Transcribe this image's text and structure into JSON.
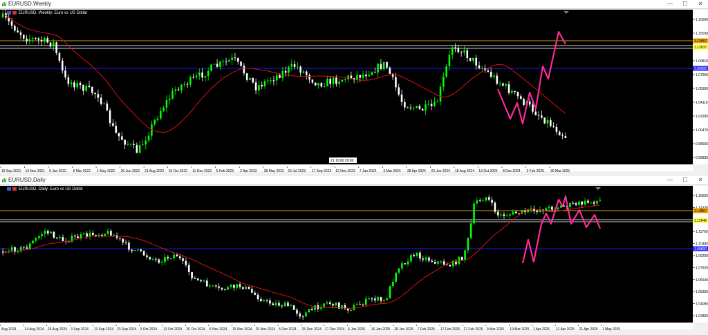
{
  "weekly": {
    "window_title": "EURUSD,Weekly",
    "chart_label": "EURUSD, Weekly: Euro vs US Dollar",
    "price_ticks": [
      "1.16500",
      "1.15030",
      "1.11190",
      "1.09810",
      "1.07950",
      "1.05930",
      "1.04110",
      "1.02290",
      "1.00470",
      "0.98650",
      "0.96830"
    ],
    "price_badges": [
      "1.13867",
      "1.12637",
      "1.00000"
    ],
    "time_ticks": [
      "19 Sep 2021",
      "14 Nov 2021",
      "9 Jan 2022",
      "6 Mar 2022",
      "1 May 2022",
      "26 Jun 2022",
      "21 Aug 2022",
      "16 Oct 2022",
      "11 Dec 2022",
      "5 Feb 2023",
      "2 Apr 2023",
      "28 May 2023",
      "23 Jul 2023",
      "17 Sep 2023",
      "12 Nov 2023",
      "7 Jan 2024",
      "3 Mar 2024",
      "28 Apr 2024",
      "23 Jun 2024",
      "18 Aug 2024",
      "13 Oct 2024",
      "8 Dec 2024",
      "2 Feb 2025",
      "30 Mar 2025"
    ],
    "crosshair_label": "21 10:00 29:00"
  },
  "daily": {
    "window_title": "EURUSD,Daily",
    "chart_label": "EURUSD, Daily: Euro vs US Dollar",
    "price_ticks": [
      "1.15600",
      "1.14320",
      "1.13000",
      "1.11760",
      "1.10480",
      "1.09200",
      "1.07920",
      "1.06640",
      "1.05360",
      "1.04080",
      "1.02800"
    ],
    "price_badges": [
      "1.13867",
      "1.12648",
      "1.09800"
    ],
    "time_ticks": [
      "Aug 2024",
      "14 Aug 2024",
      "26 Aug 2024",
      "3 Sep 2024",
      "13 Sep 2024",
      "23 Sep 2024",
      "3 Oct 2024",
      "13 Oct 2024",
      "26 Oct 2024",
      "5 Nov 2024",
      "15 Nov 2024",
      "25 Nov 2024",
      "5 Dec 2024",
      "15 Dec 2024",
      "27 Dec 2024",
      "6 Jan 2025",
      "16 Jan 2025",
      "28 Jan 2025",
      "7 Feb 2025",
      "17 Feb 2025",
      "27 Feb 2025",
      "9 Mar 2025",
      "19 Mar 2025",
      "1 Apr 2025",
      "11 Apr 2025",
      "21 Apr 2025",
      "1 May 2025"
    ]
  },
  "colors": {
    "bull": "#00ff00",
    "bear": "#ffffff",
    "ma": "#e01010",
    "hline_gold": "#c8a000",
    "hline_white": "#d0d0d0",
    "hline_blue": "#1a1aff",
    "zigzag": "#ff2a9a",
    "badge_gold": "#f0a000",
    "badge_yellow": "#ffff40",
    "badge_blue": "#2a2aff"
  },
  "window_buttons": {
    "minimize": "—",
    "maximize": "☐",
    "close": "✕"
  }
}
